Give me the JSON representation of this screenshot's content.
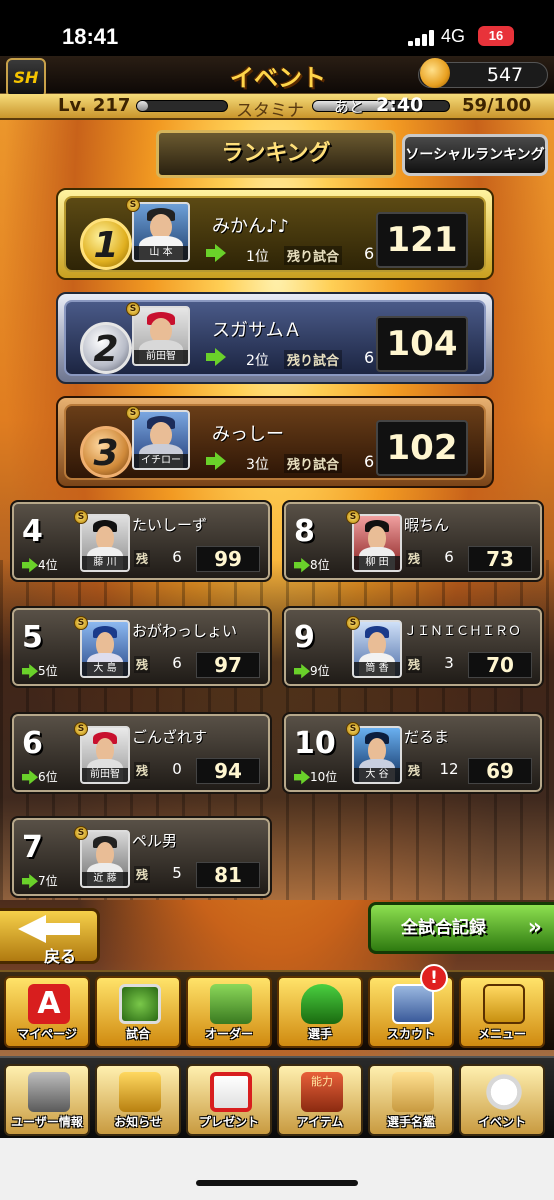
{
  "status_bar": {
    "time": "18:41",
    "network": "4G",
    "battery": "16"
  },
  "header": {
    "logo": "SH",
    "title": "イベント",
    "coins": "547"
  },
  "level_bar": {
    "level": "Lv. 217",
    "stamina_label": "スタミナ",
    "next_label": "あと",
    "recover_time": "2:40",
    "stamina": "59/100",
    "stamina_fraction": 0.59
  },
  "tabs": {
    "ranking": "ランキング",
    "social_ranking": "ソーシャルランキング"
  },
  "top_ranks": [
    {
      "rank": "1",
      "name": "みかん♪♪",
      "player": "山 本",
      "prev_rank": "1位",
      "remaining_label": "残り試合",
      "remaining": "6",
      "score": "121"
    },
    {
      "rank": "2",
      "name": "スガサムＡ",
      "player": "前田智",
      "prev_rank": "2位",
      "remaining_label": "残り試合",
      "remaining": "6",
      "score": "104"
    },
    {
      "rank": "3",
      "name": "みっしー",
      "player": "イチロー",
      "prev_rank": "3位",
      "remaining_label": "残り試合",
      "remaining": "6",
      "score": "102"
    }
  ],
  "ranks": [
    {
      "rank": "4",
      "name": "たいしーず",
      "player": "藤 川",
      "prev_rank": "4位",
      "remaining_label": "残",
      "remaining": "6",
      "score": "99"
    },
    {
      "rank": "5",
      "name": "おがわっしょい",
      "player": "大 島",
      "prev_rank": "5位",
      "remaining_label": "残",
      "remaining": "6",
      "score": "97"
    },
    {
      "rank": "6",
      "name": "ごんざれす",
      "player": "前田智",
      "prev_rank": "6位",
      "remaining_label": "残",
      "remaining": "0",
      "score": "94"
    },
    {
      "rank": "7",
      "name": "ペル男",
      "player": "近 藤",
      "prev_rank": "7位",
      "remaining_label": "残",
      "remaining": "5",
      "score": "81"
    },
    {
      "rank": "8",
      "name": "暇ちん",
      "player": "柳 田",
      "prev_rank": "8位",
      "remaining_label": "残",
      "remaining": "6",
      "score": "73"
    },
    {
      "rank": "9",
      "name": "ＪＩＮＩＣＨＩＲＯ",
      "player": "筒 香",
      "prev_rank": "9位",
      "remaining_label": "残",
      "remaining": "3",
      "score": "70"
    },
    {
      "rank": "10",
      "name": "だるま",
      "player": "大 谷",
      "prev_rank": "10位",
      "remaining_label": "残",
      "remaining": "12",
      "score": "69"
    }
  ],
  "buttons": {
    "back": "戻る",
    "all_records": "全試合記録"
  },
  "nav_main": [
    {
      "label": "マイページ",
      "icon": "letter-a-icon"
    },
    {
      "label": "試合",
      "icon": "stadium-icon"
    },
    {
      "label": "オーダー",
      "icon": "field-order-icon"
    },
    {
      "label": "選手",
      "icon": "player-icon"
    },
    {
      "label": "スカウト",
      "icon": "scout-card-icon"
    },
    {
      "label": "メニュー",
      "icon": "menu-icon"
    }
  ],
  "scout_badge": "!",
  "nav_sub": [
    {
      "label": "ユーザー情報",
      "icon": "user-info-icon"
    },
    {
      "label": "お知らせ",
      "icon": "news-icon"
    },
    {
      "label": "プレゼント",
      "icon": "gift-icon"
    },
    {
      "label": "アイテム",
      "icon": "item-book-icon",
      "icon_text": "能力"
    },
    {
      "label": "選手名鑑",
      "icon": "player-directory-icon"
    },
    {
      "label": "イベント",
      "icon": "event-baseball-icon"
    }
  ],
  "colors": {
    "gold": "#e0b020",
    "silver": "#b8bcc8",
    "bronze": "#d08a3a",
    "accent_green": "#6ad12a",
    "badge_red": "#e02020"
  }
}
